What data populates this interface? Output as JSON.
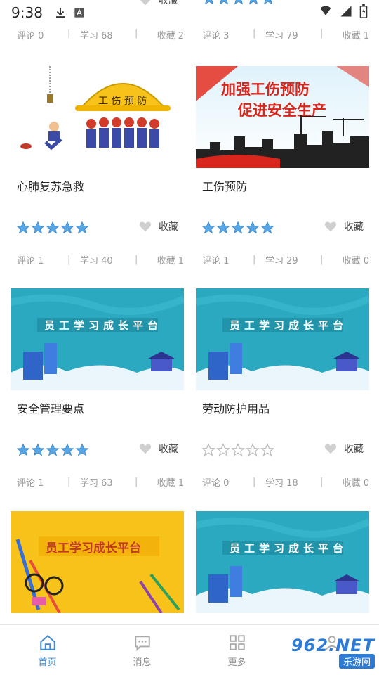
{
  "status_bar": {
    "time": "9:38"
  },
  "top_partial": {
    "left": {
      "favorite_label": "收藏",
      "comments": "评论 0",
      "learn": "学习 68",
      "favorites": "收藏 2"
    },
    "right": {
      "comments": "评论 3",
      "learn": "学习 79",
      "favorites": "收藏 1"
    }
  },
  "cards": [
    {
      "title": "心肺复苏急救",
      "rating": 5,
      "favorite_label": "收藏",
      "comments": "评论 1",
      "learn": "学习 40",
      "favorites": "收藏 1"
    },
    {
      "title": "工伤预防",
      "rating": 5,
      "favorite_label": "收藏",
      "comments": "评论 1",
      "learn": "学习 29",
      "favorites": "收藏 0",
      "banner_line1": "加强工伤预防",
      "banner_line2": "促进安全生产"
    },
    {
      "title": "安全管理要点",
      "rating": 5,
      "favorite_label": "收藏",
      "comments": "评论 1",
      "learn": "学习 63",
      "favorites": "收藏 1",
      "banner_text": "员工学习成长平台"
    },
    {
      "title": "劳动防护用品",
      "rating": 0,
      "favorite_label": "收藏",
      "comments": "评论 0",
      "learn": "学习 18",
      "favorites": "收藏 0",
      "banner_text": "员工学习成长平台"
    },
    {
      "banner_text": "员工学习成长平台"
    },
    {
      "banner_text": "员工学习成长平台"
    }
  ],
  "nav": {
    "items": [
      {
        "label": "首页",
        "icon": "home-icon",
        "active": true
      },
      {
        "label": "消息",
        "icon": "message-icon",
        "active": false
      },
      {
        "label": "更多",
        "icon": "grid-icon",
        "active": false
      }
    ]
  },
  "watermark": {
    "top_num": "962",
    "top_suffix": ".NET",
    "bottom": "乐游网"
  },
  "colors": {
    "accent": "#3d8ad6",
    "star": "#5aa7e6",
    "teal": "#2aa9c0"
  }
}
